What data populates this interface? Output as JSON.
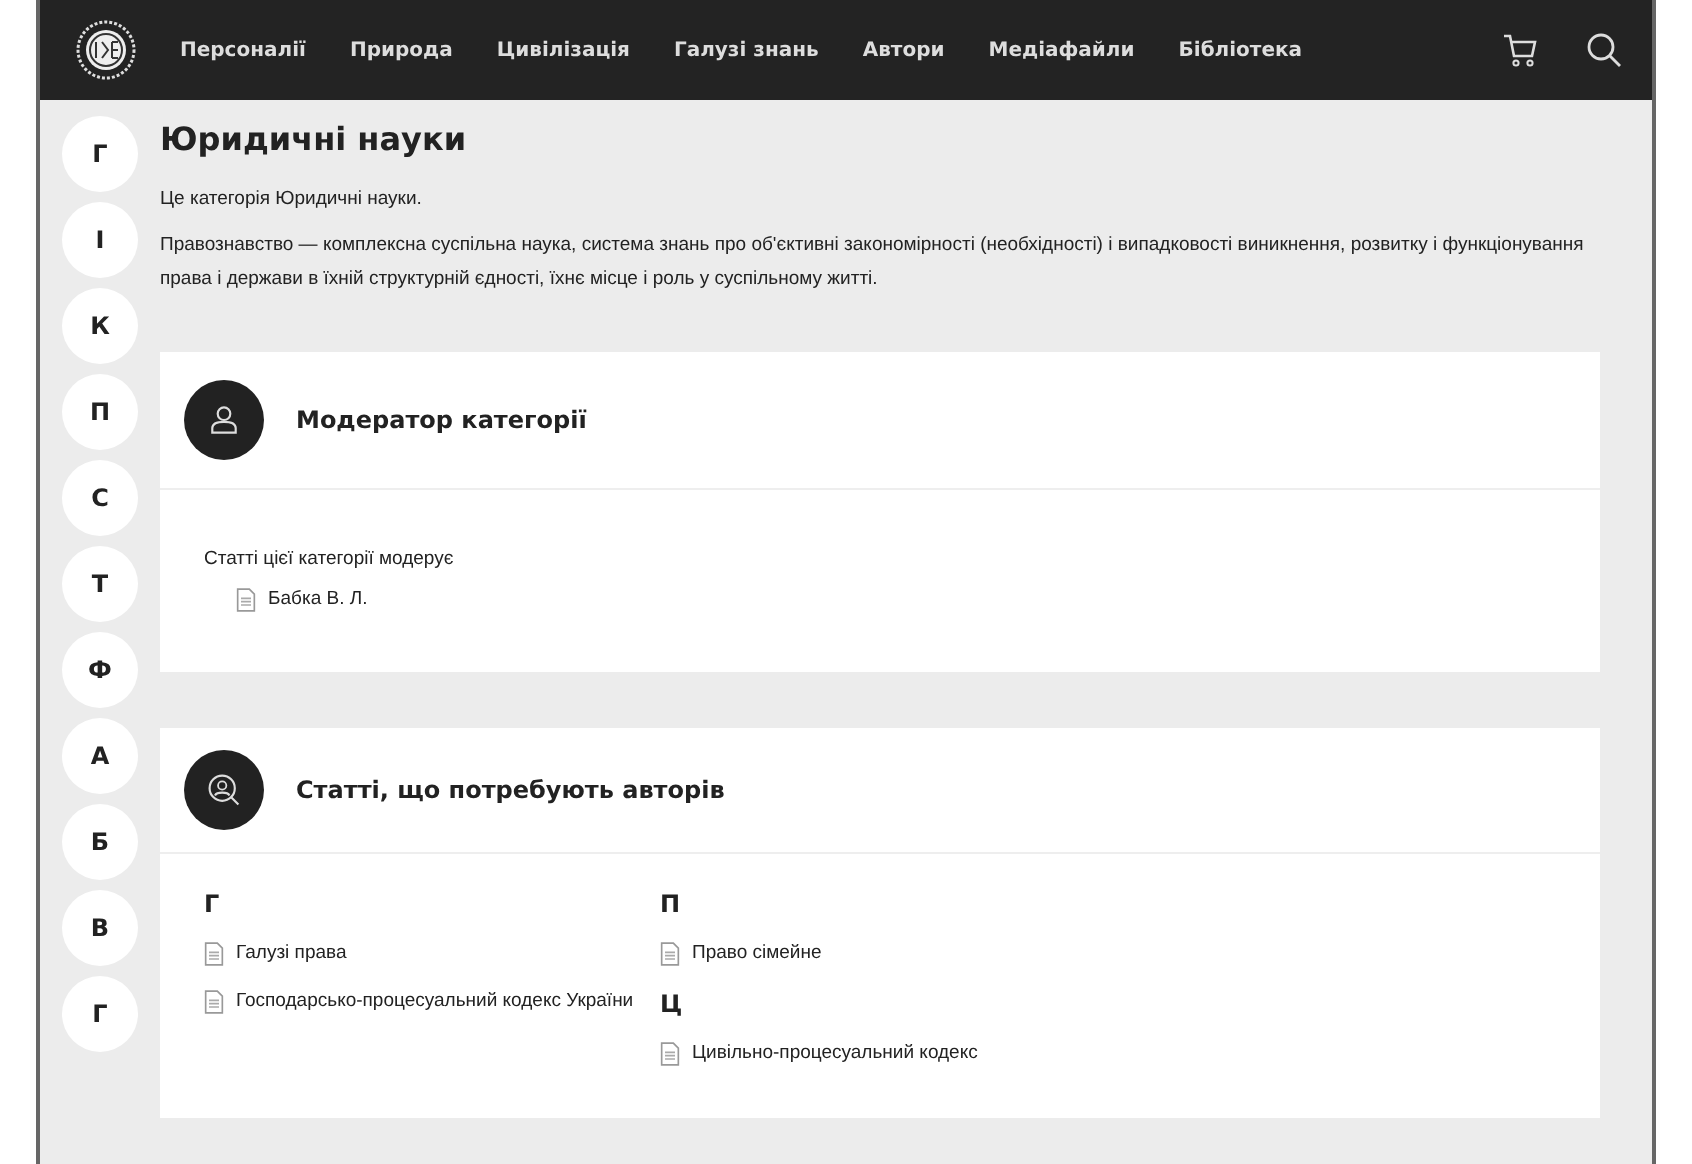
{
  "nav": {
    "items": [
      "Персоналії",
      "Природа",
      "Цивілізація",
      "Галузі знань",
      "Автори",
      "Медіафайли",
      "Бібліотека"
    ]
  },
  "alphabet": [
    "Г",
    "І",
    "К",
    "П",
    "С",
    "Т",
    "Ф",
    "А",
    "Б",
    "В",
    "Г"
  ],
  "page": {
    "title": "Юридичні науки",
    "intro": "Це категорія Юридичні науки.",
    "description": "Правознавство — комплексна суспільна наука, система знань про об'єктивні закономірності (необхідності) і випадковості виникнення, розвитку і функціонування права і держави в їхній структурній єдності, їхнє місце і роль у суспільному житті."
  },
  "sections": [
    {
      "kind": "moderator",
      "title": "Модератор категорії",
      "label": "Статті цієї категорії модерує",
      "items": [
        "Бабка В. Л."
      ]
    },
    {
      "kind": "articles",
      "title": "Статті, що потребують авторів",
      "columns": [
        [
          {
            "letter": "Г",
            "items": [
              "Галузі права",
              "Господарсько-процесуальний кодекс України"
            ]
          }
        ],
        [
          {
            "letter": "П",
            "items": [
              "Право сімейне"
            ]
          },
          {
            "letter": "Ц",
            "items": [
              "Цивільно-процесуальний кодекс"
            ]
          }
        ]
      ]
    }
  ]
}
